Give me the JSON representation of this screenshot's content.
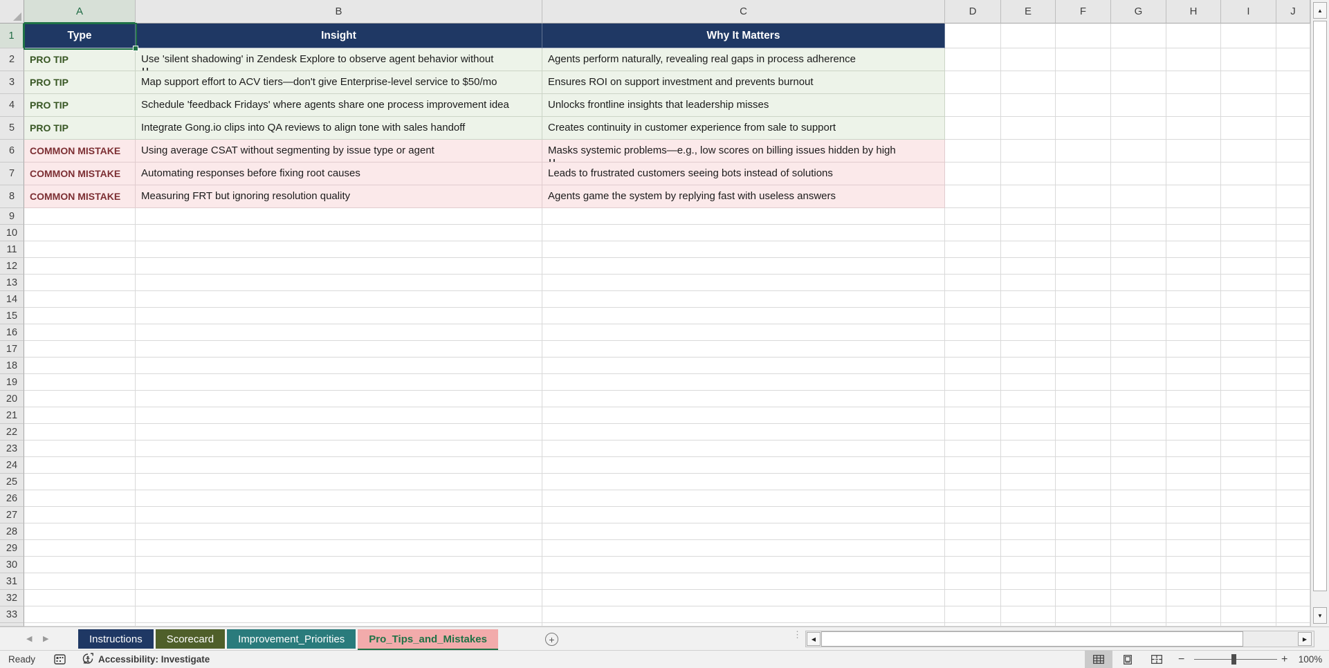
{
  "grid": {
    "column_letters": [
      "A",
      "B",
      "C",
      "D",
      "E",
      "F",
      "G",
      "H",
      "I",
      "J"
    ],
    "row_numbers": {
      "from": 1,
      "to": 33
    },
    "selected_cell": "A1",
    "selected_column": "A",
    "selected_row": 1
  },
  "sheet": {
    "headers": [
      "Type",
      "Insight",
      "Why It Matters"
    ],
    "rows": [
      {
        "type": "PRO TIP",
        "kind": "tip",
        "insight": "Use 'silent shadowing' in Zendesk Explore to observe agent behavior without",
        "insight_wrapped": true,
        "why": "Agents perform naturally, revealing real gaps in process adherence"
      },
      {
        "type": "PRO TIP",
        "kind": "tip",
        "insight": "Map support effort to ACV tiers—don't give Enterprise-level service to $50/mo",
        "why": "Ensures ROI on support investment and prevents burnout"
      },
      {
        "type": "PRO TIP",
        "kind": "tip",
        "insight": "Schedule 'feedback Fridays' where agents share one process improvement idea",
        "why": "Unlocks frontline insights that leadership misses"
      },
      {
        "type": "PRO TIP",
        "kind": "tip",
        "insight": "Integrate Gong.io clips into QA reviews to align tone with sales handoff",
        "why": "Creates continuity in customer experience from sale to support"
      },
      {
        "type": "COMMON MISTAKE",
        "kind": "mistake",
        "insight": "Using average CSAT without segmenting by issue type or agent",
        "why": "Masks systemic problems—e.g., low scores on billing issues hidden by high",
        "why_wrapped": true
      },
      {
        "type": "COMMON MISTAKE",
        "kind": "mistake",
        "insight": "Automating responses before fixing root causes",
        "why": "Leads to frustrated customers seeing bots instead of solutions"
      },
      {
        "type": "COMMON MISTAKE",
        "kind": "mistake",
        "insight": "Measuring FRT but ignoring resolution quality",
        "why": "Agents game the system by replying fast with useless answers"
      }
    ]
  },
  "sheet_tabs": [
    {
      "label": "Instructions",
      "fill": "#1F3864",
      "text": "#FFFFFF",
      "active": false
    },
    {
      "label": "Scorecard",
      "fill": "#4F5F2A",
      "text": "#FFFFFF",
      "active": false
    },
    {
      "label": "Improvement_Priorities",
      "fill": "#2A7B7C",
      "text": "#FFFFFF",
      "active": false
    },
    {
      "label": "Pro_Tips_and_Mistakes",
      "fill": "#F2ABAB",
      "text": "#1F7246",
      "active": true
    }
  ],
  "icons": {
    "tab_nav_left": "◀",
    "tab_nav_right": "▶",
    "add_sheet": "+",
    "sheet_grip": "⋮",
    "scroll_up": "▲",
    "scroll_down": "▼",
    "scroll_left": "◀",
    "scroll_right": "▶",
    "zoom_out": "−",
    "zoom_in": "+"
  },
  "status_bar": {
    "ready": "Ready",
    "accessibility": "Accessibility: Investigate",
    "zoom_level": "100%"
  },
  "colors": {
    "header_fill": "#1F3864",
    "tip_fill": "#EDF3E9",
    "tip_text": "#375623",
    "mistake_fill": "#FBE9EA",
    "mistake_text": "#7C2F33",
    "selection_green": "#1F7246",
    "tab_active_text": "#1F7246"
  }
}
